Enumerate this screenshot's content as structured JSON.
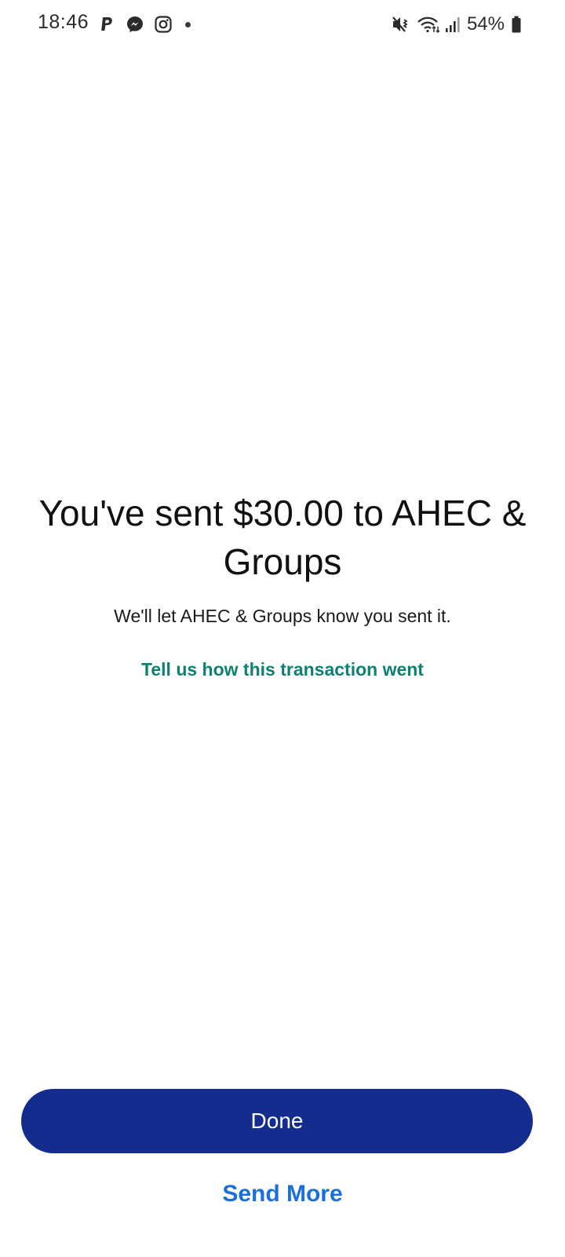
{
  "status_bar": {
    "time": "18:46",
    "notification_icons": [
      "paypal-icon",
      "messenger-icon",
      "instagram-icon",
      "more-notifications-dot"
    ],
    "system_icons": [
      "vibrate-mute-icon",
      "wifi-icon",
      "cell-signal-icon",
      "battery-icon"
    ],
    "battery_percent": "54%"
  },
  "confirmation": {
    "title": "You've sent $30.00 to AHEC & Groups",
    "subtitle": "We'll let AHEC & Groups know you sent it.",
    "feedback_link": "Tell us how this transaction went"
  },
  "actions": {
    "done_label": "Done",
    "send_more_label": "Send More"
  },
  "colors": {
    "primary_button": "#142c8e",
    "link_teal": "#0e8072",
    "link_blue": "#1b6fdc",
    "background": "#ffffff"
  }
}
